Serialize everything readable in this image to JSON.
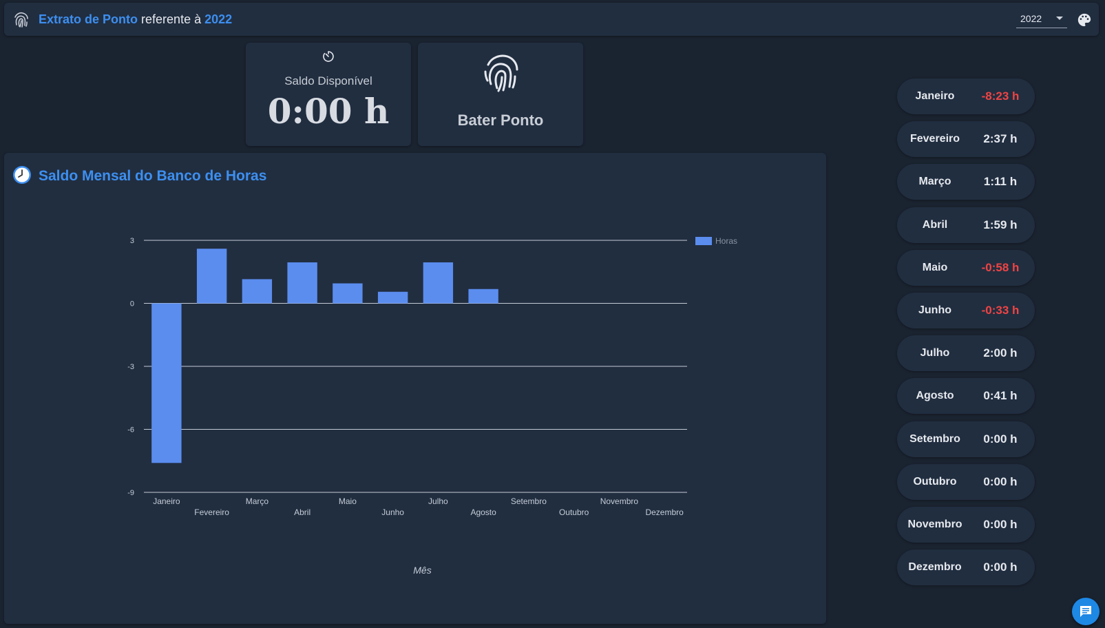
{
  "header": {
    "title_part1": "Extrato de Ponto",
    "title_part2": "referente à",
    "title_year": "2022",
    "year_select_value": "2022",
    "fingerprint_icon": "fingerprint-icon",
    "palette_icon": "palette-icon"
  },
  "saldo_card": {
    "icon": "timer-icon",
    "label": "Saldo Disponível",
    "value": "0:00 h"
  },
  "bater_card": {
    "icon": "fingerprint-icon",
    "label": "Bater Ponto"
  },
  "chart_section": {
    "icon": "clock-icon",
    "title": "Saldo Mensal do Banco de Horas"
  },
  "chart_data": {
    "type": "bar",
    "categories": [
      "Janeiro",
      "Fevereiro",
      "Março",
      "Abril",
      "Maio",
      "Junho",
      "Julho",
      "Agosto",
      "Setembro",
      "Outubro",
      "Novembro",
      "Dezembro"
    ],
    "series": [
      {
        "name": "Horas",
        "values": [
          -7.6,
          2.6,
          1.15,
          1.95,
          0.95,
          0.55,
          1.95,
          0.68,
          0,
          0,
          0,
          0
        ],
        "color": "#5b8def"
      }
    ],
    "yticks": [
      3,
      0,
      -3,
      -6,
      -9
    ],
    "ylim": [
      -9,
      3
    ],
    "xlabel": "Mês",
    "ylabel": "",
    "legend": "right",
    "grid": true
  },
  "months": [
    {
      "name": "Janeiro",
      "value": "-8:23 h",
      "negative": true
    },
    {
      "name": "Fevereiro",
      "value": "2:37 h",
      "negative": false
    },
    {
      "name": "Março",
      "value": "1:11 h",
      "negative": false
    },
    {
      "name": "Abril",
      "value": "1:59 h",
      "negative": false
    },
    {
      "name": "Maio",
      "value": "-0:58 h",
      "negative": true
    },
    {
      "name": "Junho",
      "value": "-0:33 h",
      "negative": true
    },
    {
      "name": "Julho",
      "value": "2:00 h",
      "negative": false
    },
    {
      "name": "Agosto",
      "value": "0:41 h",
      "negative": false
    },
    {
      "name": "Setembro",
      "value": "0:00 h",
      "negative": false
    },
    {
      "name": "Outubro",
      "value": "0:00 h",
      "negative": false
    },
    {
      "name": "Novembro",
      "value": "0:00 h",
      "negative": false
    },
    {
      "name": "Dezembro",
      "value": "0:00 h",
      "negative": false
    }
  ],
  "colors": {
    "accent": "#3d8ff0",
    "negative": "#f04444",
    "positive": "#e6e9ee",
    "bar": "#5b8def"
  },
  "chat_button": {
    "icon": "chat-icon"
  }
}
